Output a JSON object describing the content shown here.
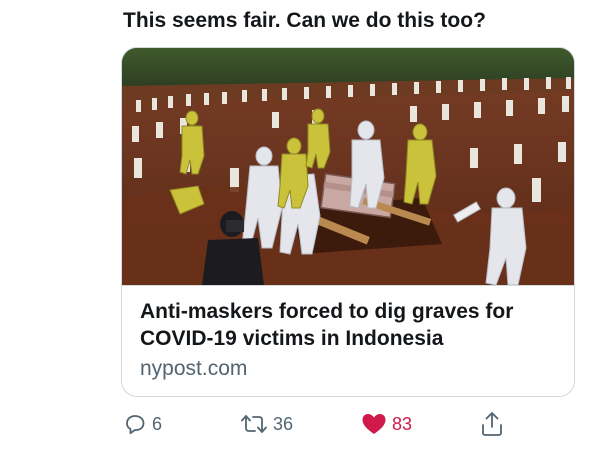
{
  "tweet": {
    "text": "This seems fair. Can we do this too?"
  },
  "card": {
    "title": "Anti-maskers forced to dig graves for COVID-19 victims in Indonesia",
    "domain": "nypost.com",
    "image_icon": "photo-graveyard"
  },
  "actions": {
    "reply": {
      "icon": "reply-icon",
      "count": "6"
    },
    "retweet": {
      "icon": "retweet-icon",
      "count": "36"
    },
    "like": {
      "icon": "heart-icon",
      "count": "83",
      "liked": true,
      "color": "#d11a4b"
    },
    "share": {
      "icon": "share-icon"
    }
  },
  "colors": {
    "text": "#14171a",
    "secondary": "#536471",
    "border": "#cfd9de",
    "like": "#d11a4b"
  }
}
